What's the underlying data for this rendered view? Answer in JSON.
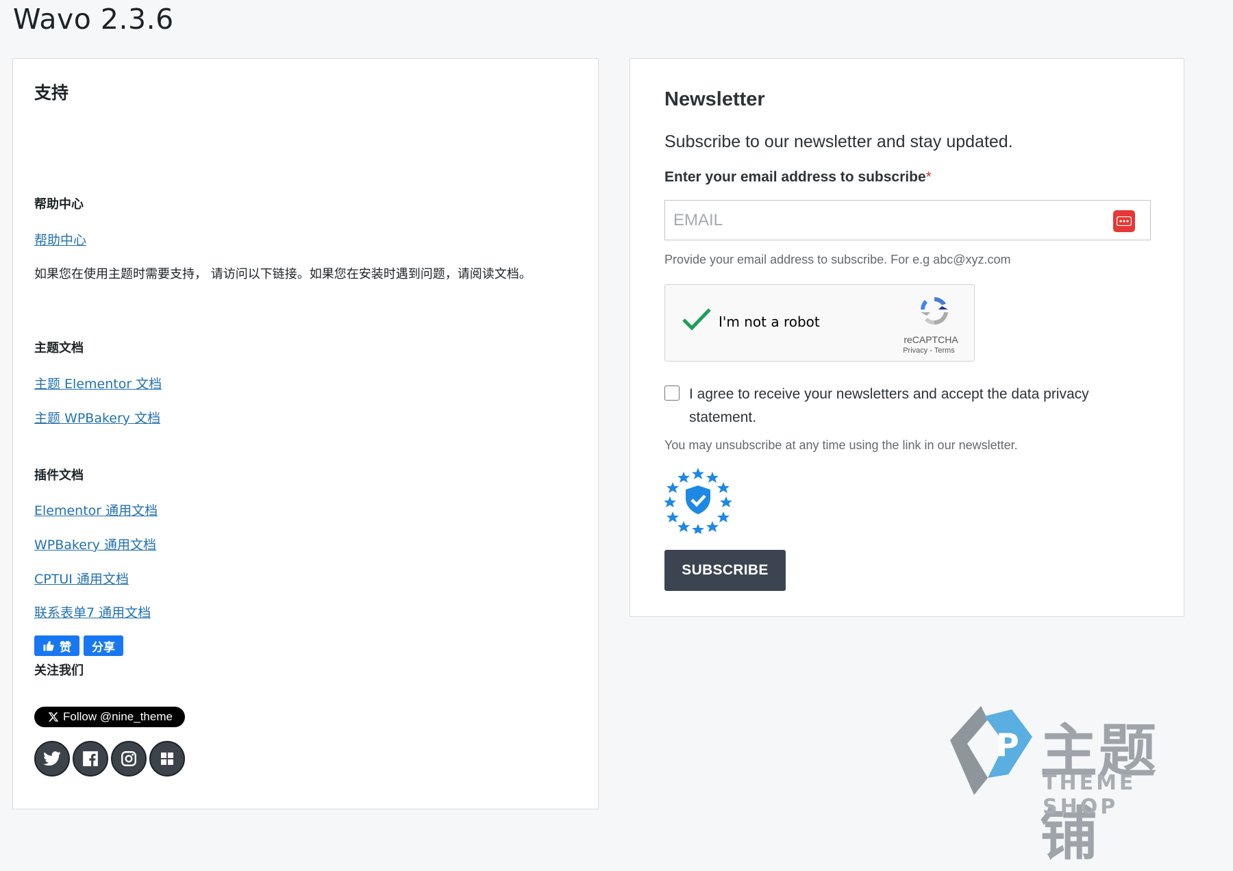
{
  "page": {
    "title": "Wavo 2.3.6"
  },
  "support": {
    "title": "支持",
    "help": {
      "heading": "帮助中心",
      "link": "帮助中心",
      "description": "如果您在使用主题时需要支持， 请访问以下链接。如果您在安装时遇到问题，请阅读文档。"
    },
    "theme_docs": {
      "heading": "主题文档",
      "links": [
        "主题 Elementor 文档",
        "主题 WPBakery 文档"
      ]
    },
    "plugin_docs": {
      "heading": "插件文档",
      "links": [
        "Elementor 通用文档",
        "WPBakery 通用文档",
        "CPTUI 通用文档",
        "联系表单7 通用文档"
      ]
    },
    "follow": {
      "heading": "关注我们",
      "like_label": "赞",
      "share_label": "分享",
      "x_follow_label": "Follow @nine_theme",
      "social_icons": [
        "twitter-icon",
        "facebook-icon",
        "instagram-icon",
        "grid-icon"
      ]
    }
  },
  "newsletter": {
    "title": "Newsletter",
    "subtitle": "Subscribe to our newsletter and stay updated.",
    "email_label": "Enter your email address to subscribe",
    "required_mark": "*",
    "email_placeholder": "EMAIL",
    "email_value": "",
    "hint": "Provide your email address to subscribe. For e.g abc@xyz.com",
    "recaptcha": {
      "label": "I'm not a robot",
      "brand": "reCAPTCHA",
      "privacy": "Privacy",
      "separator": " - ",
      "terms": "Terms"
    },
    "agree_text": "I agree to receive your newsletters and accept the data privacy statement.",
    "unsubscribe_text": "You may unsubscribe at any time using the link in our newsletter.",
    "subscribe_label": "SUBSCRIBE"
  },
  "watermark": {
    "cn": "主题铺",
    "en": "THEME SHOP"
  },
  "colors": {
    "link": "#2271b1",
    "facebook": "#1877f2",
    "subscribe_bg": "#3c4451",
    "required": "#d63638",
    "eu_badge": "#1e88e5"
  }
}
